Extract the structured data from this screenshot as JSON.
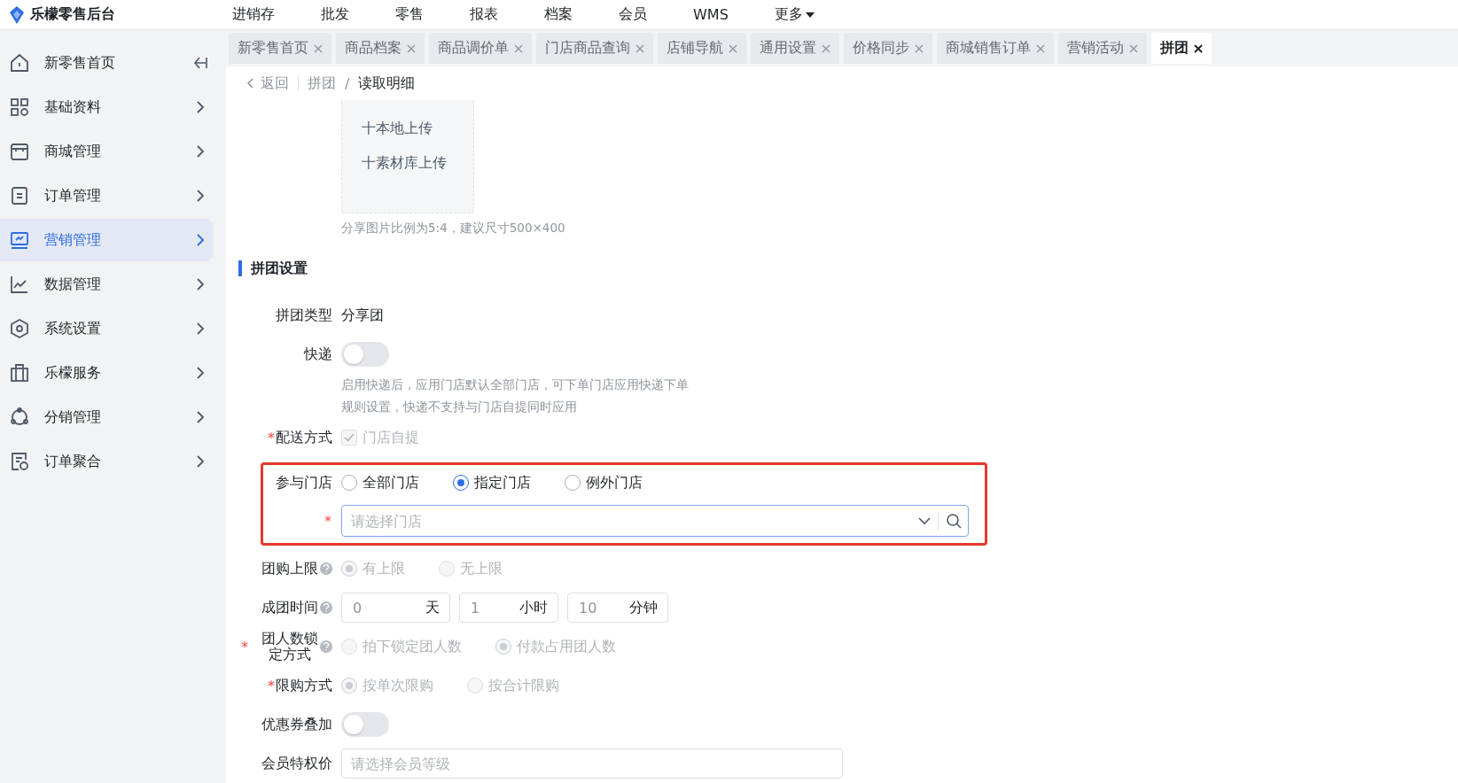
{
  "app": {
    "title": "乐檬零售后台"
  },
  "top_nav": [
    {
      "label": "进销存",
      "dropdown": false
    },
    {
      "label": "批发",
      "dropdown": false
    },
    {
      "label": "零售",
      "dropdown": false
    },
    {
      "label": "报表",
      "dropdown": false
    },
    {
      "label": "档案",
      "dropdown": false
    },
    {
      "label": "会员",
      "dropdown": false
    },
    {
      "label": "WMS",
      "dropdown": false
    },
    {
      "label": "更多",
      "dropdown": true
    }
  ],
  "sidebar": {
    "items": [
      {
        "label": "新零售首页",
        "selected": false
      },
      {
        "label": "基础资料",
        "selected": false
      },
      {
        "label": "商城管理",
        "selected": false
      },
      {
        "label": "订单管理",
        "selected": false
      },
      {
        "label": "营销管理",
        "selected": true
      },
      {
        "label": "数据管理",
        "selected": false
      },
      {
        "label": "系统设置",
        "selected": false
      },
      {
        "label": "乐檬服务",
        "selected": false
      },
      {
        "label": "分销管理",
        "selected": false
      },
      {
        "label": "订单聚合",
        "selected": false
      }
    ]
  },
  "tabs": [
    {
      "label": "新零售首页",
      "selected": false
    },
    {
      "label": "商品档案",
      "selected": false
    },
    {
      "label": "商品调价单",
      "selected": false
    },
    {
      "label": "门店商品查询",
      "selected": false
    },
    {
      "label": "店铺导航",
      "selected": false
    },
    {
      "label": "通用设置",
      "selected": false
    },
    {
      "label": "价格同步",
      "selected": false
    },
    {
      "label": "商城销售订单",
      "selected": false
    },
    {
      "label": "营销活动",
      "selected": false
    },
    {
      "label": "拼团",
      "selected": true
    }
  ],
  "breadcrumb": {
    "back": "返回",
    "items": [
      "拼团",
      "读取明细"
    ],
    "separator": "/"
  },
  "upload": {
    "actions": [
      "十本地上传",
      "十素材库上传"
    ],
    "hint": "分享图片比例为5:4，建议尺寸500×400"
  },
  "section_title": "拼团设置",
  "form": [
    {
      "kind": "text",
      "label": "拼团类型",
      "value": "分享团"
    },
    {
      "kind": "switch",
      "label": "快递",
      "on": false,
      "hint": [
        "启用快递后，应用门店默认全部门店，可下单门店应用快递下单",
        "规则设置，快递不支持与门店自提同时应用"
      ]
    },
    {
      "kind": "checkbox",
      "label": "配送方式",
      "required_mark": "*",
      "options": [
        {
          "label": "门店自提",
          "checked": true,
          "disabled": true
        }
      ]
    },
    {
      "kind": "radio",
      "label": "参与门店",
      "highlighted": true,
      "options": [
        {
          "label": "全部门店",
          "selected": false,
          "disabled": false
        },
        {
          "label": "指定门店",
          "selected": true,
          "disabled": false
        },
        {
          "label": "例外门店",
          "selected": false,
          "disabled": false
        }
      ],
      "select": {
        "placeholder": "请选择门店",
        "required_mark": "*"
      }
    },
    {
      "kind": "radio",
      "label": "团购上限",
      "help": true,
      "options": [
        {
          "label": "有上限",
          "selected": true,
          "disabled": true
        },
        {
          "label": "无上限",
          "selected": false,
          "disabled": true
        }
      ]
    },
    {
      "kind": "duration",
      "label": "成团时间",
      "help": true,
      "fields": [
        {
          "placeholder": "0",
          "unit": "天"
        },
        {
          "placeholder": "1",
          "unit": "小时"
        },
        {
          "placeholder": "10",
          "unit": "分钟"
        }
      ]
    },
    {
      "kind": "radio",
      "label": "团人数锁定方式",
      "help": true,
      "required_mark": "*",
      "options": [
        {
          "label": "拍下锁定团人数",
          "selected": false,
          "disabled": true
        },
        {
          "label": "付款占用团人数",
          "selected": true,
          "disabled": true
        }
      ]
    },
    {
      "kind": "radio",
      "label": "限购方式",
      "required_mark": "*",
      "options": [
        {
          "label": "按单次限购",
          "selected": true,
          "disabled": true
        },
        {
          "label": "按合计限购",
          "selected": false,
          "disabled": true
        }
      ]
    },
    {
      "kind": "switch",
      "label": "优惠券叠加",
      "on": false
    },
    {
      "kind": "input",
      "label": "会员特权价",
      "placeholder": "请选择会员等级"
    }
  ]
}
